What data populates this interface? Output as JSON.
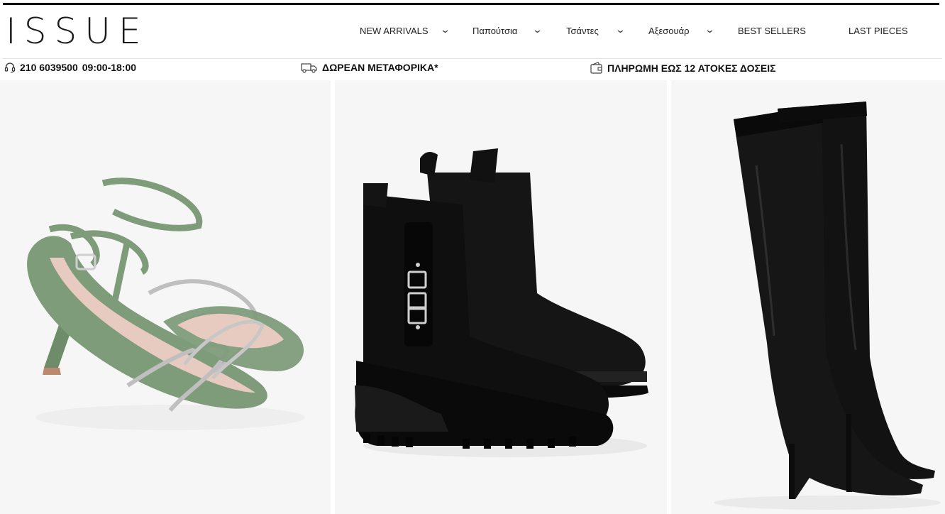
{
  "brand": {
    "logo_text": "ISSUE"
  },
  "nav": {
    "items": [
      {
        "label": "NEW ARRIVALS",
        "has_dropdown": true
      },
      {
        "label": "Παπούτσια",
        "has_dropdown": true
      },
      {
        "label": "Τσάντες",
        "has_dropdown": true
      },
      {
        "label": "Αξεσουάρ",
        "has_dropdown": true
      },
      {
        "label": "BEST SELLERS",
        "has_dropdown": false
      },
      {
        "label": "LAST PIECES",
        "has_dropdown": false
      }
    ],
    "dropdown_icon": "chevron-down-icon"
  },
  "info_bar": {
    "phone": {
      "icon": "headset-icon",
      "number": "210 6039500",
      "hours": "09:00-18:00"
    },
    "shipping": {
      "icon": "truck-icon",
      "text": "ΔΩΡΕΑΝ ΜΕΤΑΦΟΡΙΚΑ*"
    },
    "payment": {
      "icon": "wallet-icon",
      "text": "ΠΛΗΡΩΜΗ ΕΩΣ 12 ΑΤΟΚΕΣ ΔΟΣΕΙΣ"
    }
  },
  "products": [
    {
      "name": "green-strappy-sandal",
      "color": "#7f9c7a"
    },
    {
      "name": "black-chelsea-boot",
      "color": "#111111"
    },
    {
      "name": "black-over-knee-boot",
      "color": "#141414"
    }
  ],
  "colors": {
    "text": "#111111",
    "rule": "#000000",
    "tile_bg": "#f6f6f6"
  }
}
